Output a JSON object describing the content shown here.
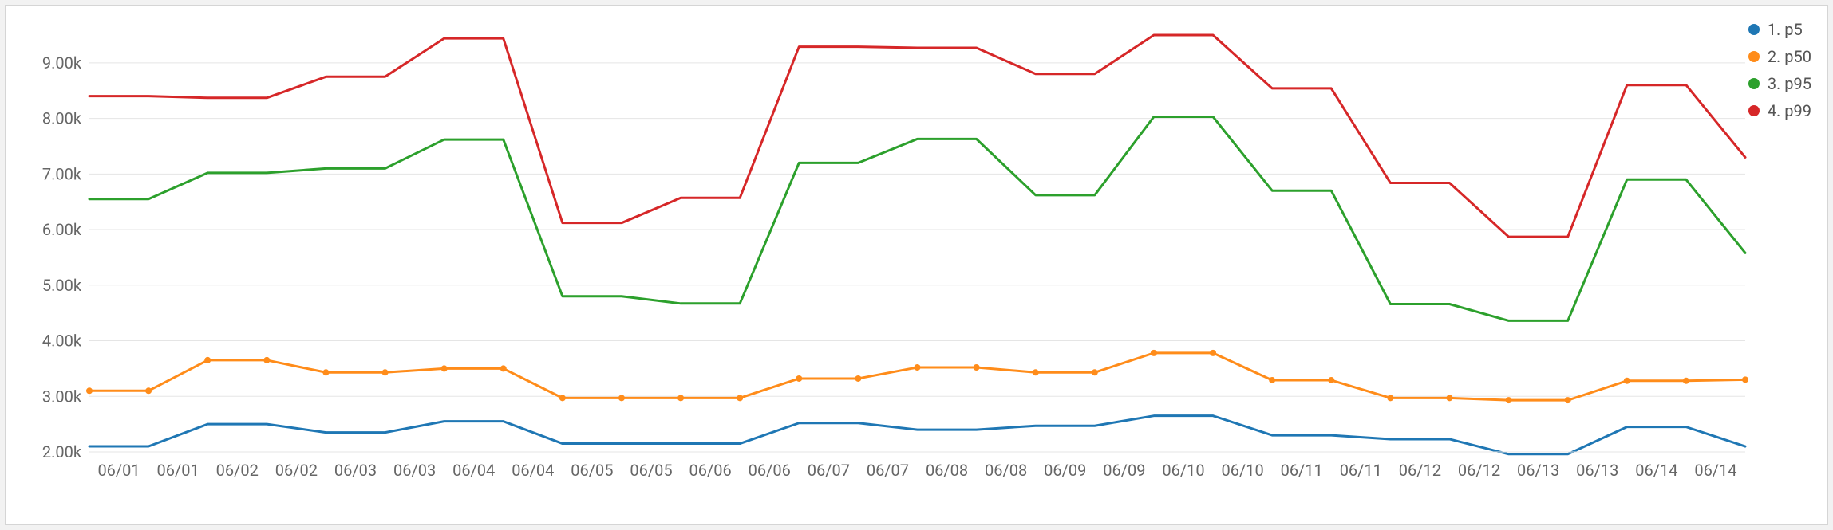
{
  "chart_data": {
    "type": "line",
    "title": "",
    "xlabel": "",
    "ylabel": "",
    "ylim": [
      2000,
      9600
    ],
    "y_ticks": [
      2000,
      3000,
      4000,
      5000,
      6000,
      7000,
      8000,
      9000
    ],
    "y_tick_labels": [
      "2.00k",
      "3.00k",
      "4.00k",
      "5.00k",
      "6.00k",
      "7.00k",
      "8.00k",
      "9.00k"
    ],
    "categories": [
      "06/01",
      "06/01",
      "06/02",
      "06/02",
      "06/03",
      "06/03",
      "06/04",
      "06/04",
      "06/05",
      "06/05",
      "06/06",
      "06/06",
      "06/07",
      "06/07",
      "06/08",
      "06/08",
      "06/09",
      "06/09",
      "06/10",
      "06/10",
      "06/11",
      "06/11",
      "06/12",
      "06/12",
      "06/13",
      "06/13",
      "06/14",
      "06/14"
    ],
    "series": [
      {
        "name": "1. p5",
        "color": "#1f77b4",
        "values": [
          2100,
          2100,
          2500,
          2500,
          2350,
          2350,
          2550,
          2550,
          2150,
          2150,
          2150,
          2150,
          2520,
          2520,
          2400,
          2400,
          2470,
          2470,
          2650,
          2650,
          2300,
          2300,
          2230,
          2230,
          1960,
          1960,
          2450,
          2450,
          2100
        ]
      },
      {
        "name": "2. p50",
        "color": "#ff8c1a",
        "values": [
          3100,
          3100,
          3650,
          3650,
          3430,
          3430,
          3500,
          3500,
          2970,
          2970,
          2970,
          2970,
          3320,
          3320,
          3520,
          3520,
          3430,
          3430,
          3780,
          3780,
          3290,
          3290,
          2970,
          2970,
          2930,
          2930,
          3280,
          3280,
          3300
        ]
      },
      {
        "name": "3. p95",
        "color": "#2ca02c",
        "values": [
          6550,
          6550,
          7020,
          7020,
          7100,
          7100,
          7620,
          7620,
          4800,
          4800,
          4670,
          4670,
          7200,
          7200,
          7630,
          7630,
          6620,
          6620,
          8030,
          8030,
          6700,
          6700,
          4660,
          4660,
          4360,
          4360,
          6900,
          6900,
          5580
        ]
      },
      {
        "name": "4. p99",
        "color": "#d62728",
        "values": [
          8400,
          8400,
          8370,
          8370,
          8750,
          8750,
          9440,
          9440,
          6120,
          6120,
          6570,
          6570,
          9290,
          9290,
          9270,
          9270,
          8800,
          8800,
          9500,
          9500,
          8540,
          8540,
          6840,
          6840,
          5870,
          5870,
          8600,
          8600,
          7300
        ]
      }
    ],
    "legend_position": "top-right",
    "grid": true
  }
}
